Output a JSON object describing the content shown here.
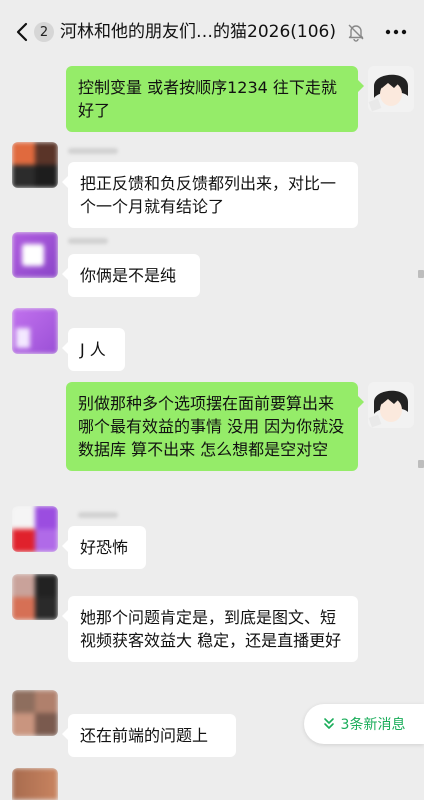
{
  "header": {
    "back_icon": "chevron-left-icon",
    "unread_count": "2",
    "title": "河林和他的朋友们…的猫2026(106)",
    "mute_icon": "bell-muted-icon",
    "more_icon": "more-icon"
  },
  "messages": [
    {
      "side": "out",
      "text": "控制变量 或者按顺序1234 往下走就好了"
    },
    {
      "side": "in",
      "text": "把正反馈和负反馈都列出来，对比一个一个月就有结论了"
    },
    {
      "side": "in",
      "text": "你俩是不是纯"
    },
    {
      "side": "in",
      "text": "J 人"
    },
    {
      "side": "out",
      "text": "别做那种多个选项摆在面前要算出来哪个最有效益的事情   没用  因为你就没数据库  算不出来   怎么想都是空对空"
    },
    {
      "side": "in",
      "text": "好恐怖"
    },
    {
      "side": "in",
      "text": "她那个问题肯定是，到底是图文、短视频获客效益大 稳定，还是直播更好"
    },
    {
      "side": "in",
      "text": "还在前端的问题上"
    }
  ],
  "new_messages": {
    "label": "3条新消息",
    "icon": "double-chevron-down-icon"
  },
  "colors": {
    "background": "#ededed",
    "outgoing": "#95ec69",
    "incoming": "#ffffff",
    "accent": "#1aad5a"
  }
}
